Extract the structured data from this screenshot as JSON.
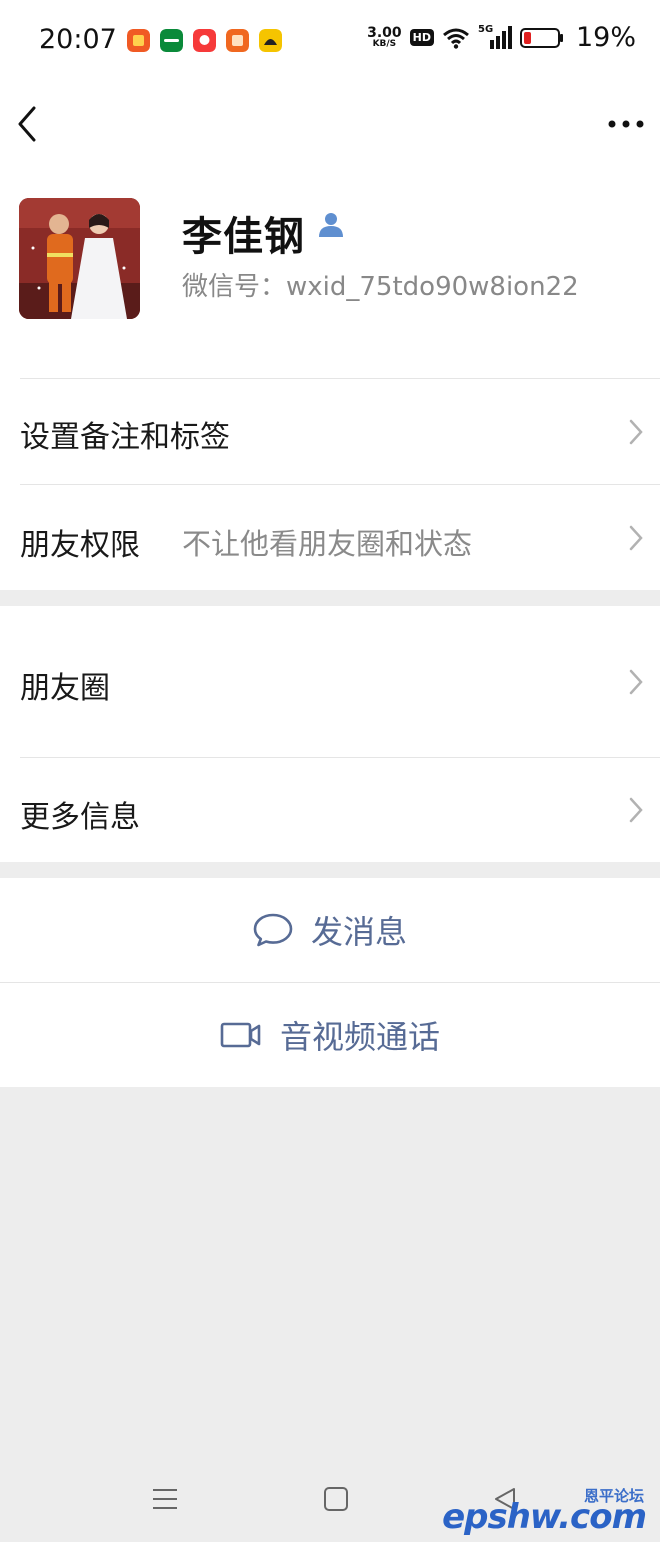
{
  "status_bar": {
    "time": "20:07",
    "net_speed_value": "3.00",
    "net_speed_unit": "KB/S",
    "hd_label": "HD",
    "signal_label": "5G",
    "battery_percent": "19%",
    "app_icons": [
      {
        "name": "meituan-app-icon",
        "color": "#f05a24"
      },
      {
        "name": "oppo-app-icon",
        "color": "#0a8a3a"
      },
      {
        "name": "taobao-app-icon",
        "color": "#f63a3a"
      },
      {
        "name": "taobao-special-app-icon",
        "color": "#f06820"
      },
      {
        "name": "amap-app-icon",
        "color": "#f5c400"
      }
    ]
  },
  "profile": {
    "name": "李佳钢",
    "wechat_id": "微信号：wxid_75tdo90w8ion22"
  },
  "rows": {
    "remarks_label": "设置备注和标签",
    "permissions_label": "朋友权限",
    "permissions_value": "不让他看朋友圈和状态",
    "moments_label": "朋友圈",
    "more_info_label": "更多信息"
  },
  "actions": {
    "send_message_label": "发消息",
    "video_call_label": "音视频通话"
  },
  "watermark": {
    "main": "epshw.com",
    "sub": "恩平论坛"
  },
  "colors": {
    "link_blue": "#576b95",
    "separator_gray": "#ededed"
  }
}
